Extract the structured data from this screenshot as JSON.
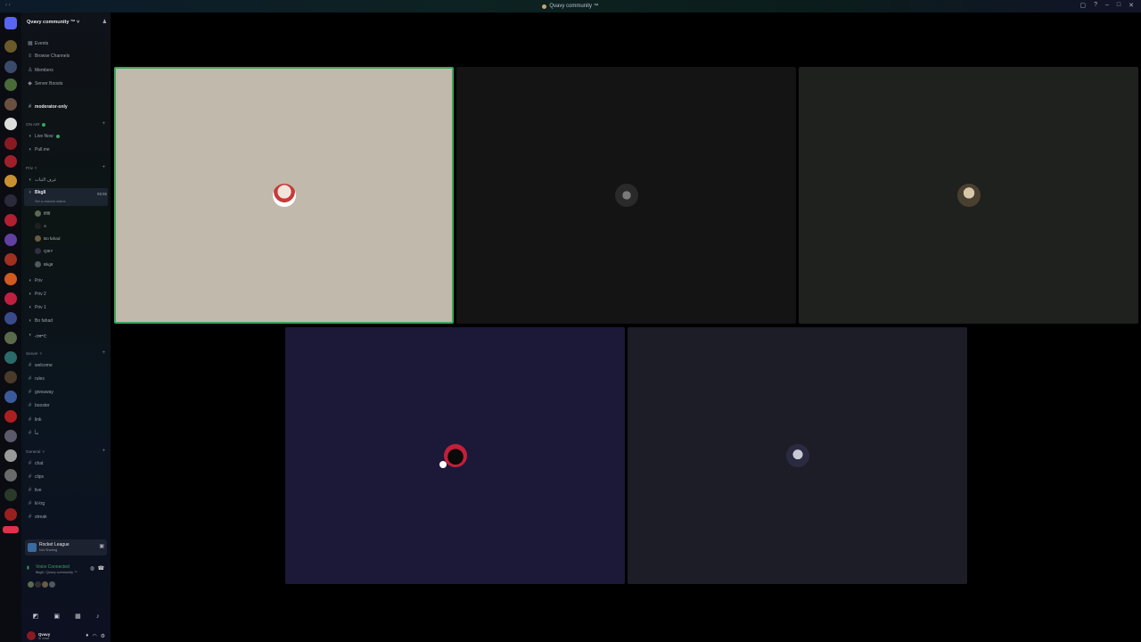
{
  "window": {
    "title": "Qvavy community ™"
  },
  "server": {
    "name": "Qvavy community ™"
  },
  "menu": [
    {
      "label": "Events"
    },
    {
      "label": "Browse Channels"
    },
    {
      "label": "Members"
    },
    {
      "label": "Server Boosts"
    }
  ],
  "moderator_channel": "moderator-only",
  "categories": {
    "on_air": "ON AIR",
    "priv": "Priv",
    "server": "Server",
    "general": "General"
  },
  "on_air_channels": [
    {
      "label": "Live Now"
    },
    {
      "label": "Pull.me"
    }
  ],
  "priv_channels": [
    {
      "label": "غرف الثبات"
    },
    {
      "label": "Bkg8",
      "status": "Set a channel status",
      "timer": "55:55"
    }
  ],
  "voice_users": [
    {
      "label": "ffffff"
    },
    {
      "label": "A"
    },
    {
      "label": "Bo fahad"
    },
    {
      "label": "QIIIY"
    },
    {
      "label": "Bkg8"
    }
  ],
  "priv_more": [
    {
      "label": "Priv"
    },
    {
      "label": "Priv 2"
    },
    {
      "label": "Priv 1"
    },
    {
      "label": "Bo fahad"
    },
    {
      "label": "ﺝﻣﻬﻭﺭ."
    }
  ],
  "server_channels": [
    {
      "label": "welcome"
    },
    {
      "label": "rules"
    },
    {
      "label": "giveaway"
    },
    {
      "label": "booster"
    },
    {
      "label": "link"
    },
    {
      "label": "نبأ"
    }
  ],
  "general_channels": [
    {
      "label": "chat"
    },
    {
      "label": "clips"
    },
    {
      "label": "live"
    },
    {
      "label": "kl-trg"
    },
    {
      "label": "streak"
    }
  ],
  "activity": {
    "game": "Rocket League",
    "status": "Not Sharing"
  },
  "voice": {
    "status": "Voice Connected",
    "location": "Bkg8 / Qvavy community ™"
  },
  "user": {
    "name": "Qvavy",
    "status": "In voice"
  },
  "colors": {
    "speaking": "#3ba55c",
    "accent": "#5865f2"
  }
}
